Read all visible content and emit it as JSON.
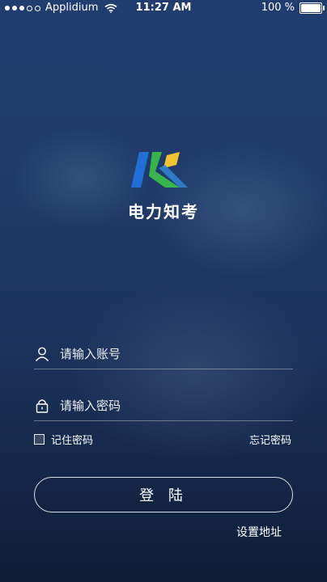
{
  "status_bar": {
    "carrier": "Applidium",
    "time": "11:27 AM",
    "battery": "100 %",
    "battery_level": 1.0
  },
  "app": {
    "name": "电力知考",
    "logo_colors": [
      "#1f6fd6",
      "#38b54a",
      "#f2c230"
    ]
  },
  "login_form": {
    "account_placeholder": "请输入账号",
    "password_placeholder": "请输入密码",
    "remember_label": "记住密码",
    "remember_checked": false,
    "forgot_label": "忘记密码",
    "login_label": "登 陆",
    "settings_label": "设置地址"
  }
}
